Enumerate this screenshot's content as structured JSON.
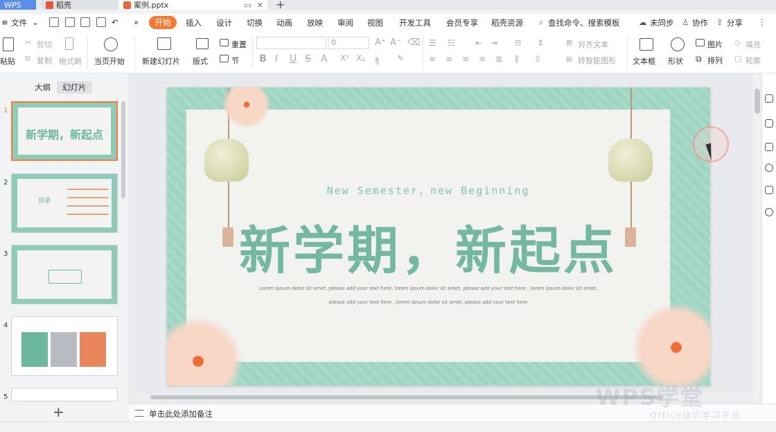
{
  "tabs": {
    "wps": "WPS",
    "daoke": "稻壳",
    "file": "案例.pptx"
  },
  "menu": {
    "file": "文件",
    "items": [
      "开始",
      "插入",
      "设计",
      "切换",
      "动画",
      "放映",
      "审阅",
      "视图",
      "开发工具",
      "会员专享",
      "稻壳资源"
    ],
    "search": "查找命令、搜索模板",
    "sync": "未同步",
    "collab": "协作",
    "share": "分享"
  },
  "ribbon": {
    "paste": "粘贴",
    "cut": "剪切",
    "copy": "复制",
    "format_painter": "格式刷",
    "from_current": "当页开始",
    "new_slide": "新建幻灯片",
    "layout": "版式",
    "section": "节",
    "reset": "重置",
    "font_size": "0",
    "align_text": "对齐文本",
    "smartart": "转智能图形",
    "textbox": "文本框",
    "shape": "形状",
    "picture": "图片",
    "fill": "填充",
    "arrange": "排列",
    "outline": "轮廓"
  },
  "left_panel": {
    "tab_outline": "大纲",
    "tab_slides": "幻灯片",
    "slide_numbers": [
      "1",
      "2",
      "3",
      "4",
      "5"
    ],
    "thumb1_title": "新学期，新起点",
    "thumb2_title": "目录"
  },
  "slide": {
    "subtitle": "New Semester，new Beginning",
    "title": "新学期，新起点",
    "body_line1": "Lorem ipsum dolor sit amet, please add your text here, lorem ipsum dolor sit amet, please add your text here , lorem ipsum dolor sit amet,",
    "body_line2": "please add your text here , lorem ipsum dolor sit amet, please add your text here"
  },
  "notes": {
    "placeholder": "单击此处添加备注"
  },
  "watermark": {
    "brand": "WPS学堂",
    "tagline": "Office技巧学习平台"
  },
  "colors": {
    "accent": "#f57a33",
    "slide_green": "#74b99f",
    "tab_blue": "#5b8ee8"
  }
}
